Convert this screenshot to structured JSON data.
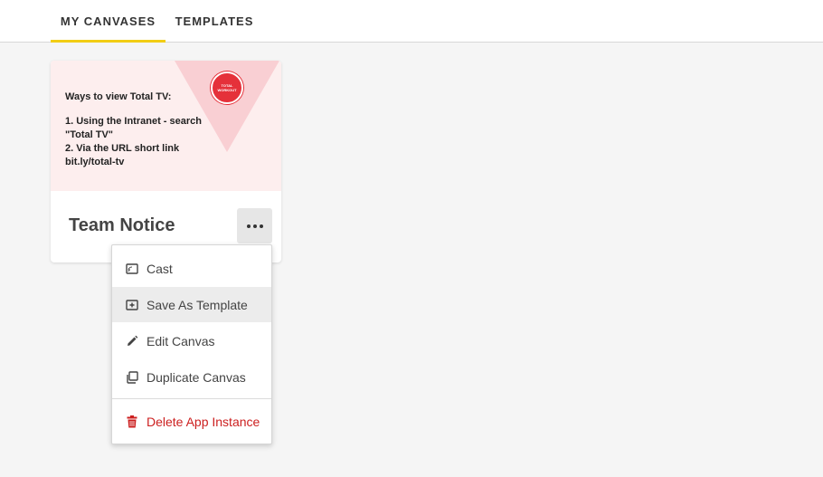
{
  "tabs": [
    {
      "label": "MY CANVASES",
      "active": true
    },
    {
      "label": "TEMPLATES",
      "active": false
    }
  ],
  "accent_color": "#f2cd14",
  "card": {
    "title": "Team Notice",
    "thumbnail": {
      "heading": "Ways to view Total TV:",
      "line1": "1. Using the Intranet - search",
      "line2": "\"Total TV\"",
      "line3": "2. Via the URL short link",
      "line4": "bit.ly/total-tv",
      "badge_text": "TOTAL WORKOUT"
    },
    "more_icon": "ellipsis-icon"
  },
  "menu": {
    "items": [
      {
        "label": "Cast",
        "icon": "cast-icon"
      },
      {
        "label": "Save As Template",
        "icon": "save-template-icon"
      },
      {
        "label": "Edit Canvas",
        "icon": "pencil-icon"
      },
      {
        "label": "Duplicate Canvas",
        "icon": "duplicate-icon"
      },
      {
        "label": "Delete App Instance",
        "icon": "trash-icon"
      }
    ],
    "danger_color": "#cc1f1f"
  }
}
